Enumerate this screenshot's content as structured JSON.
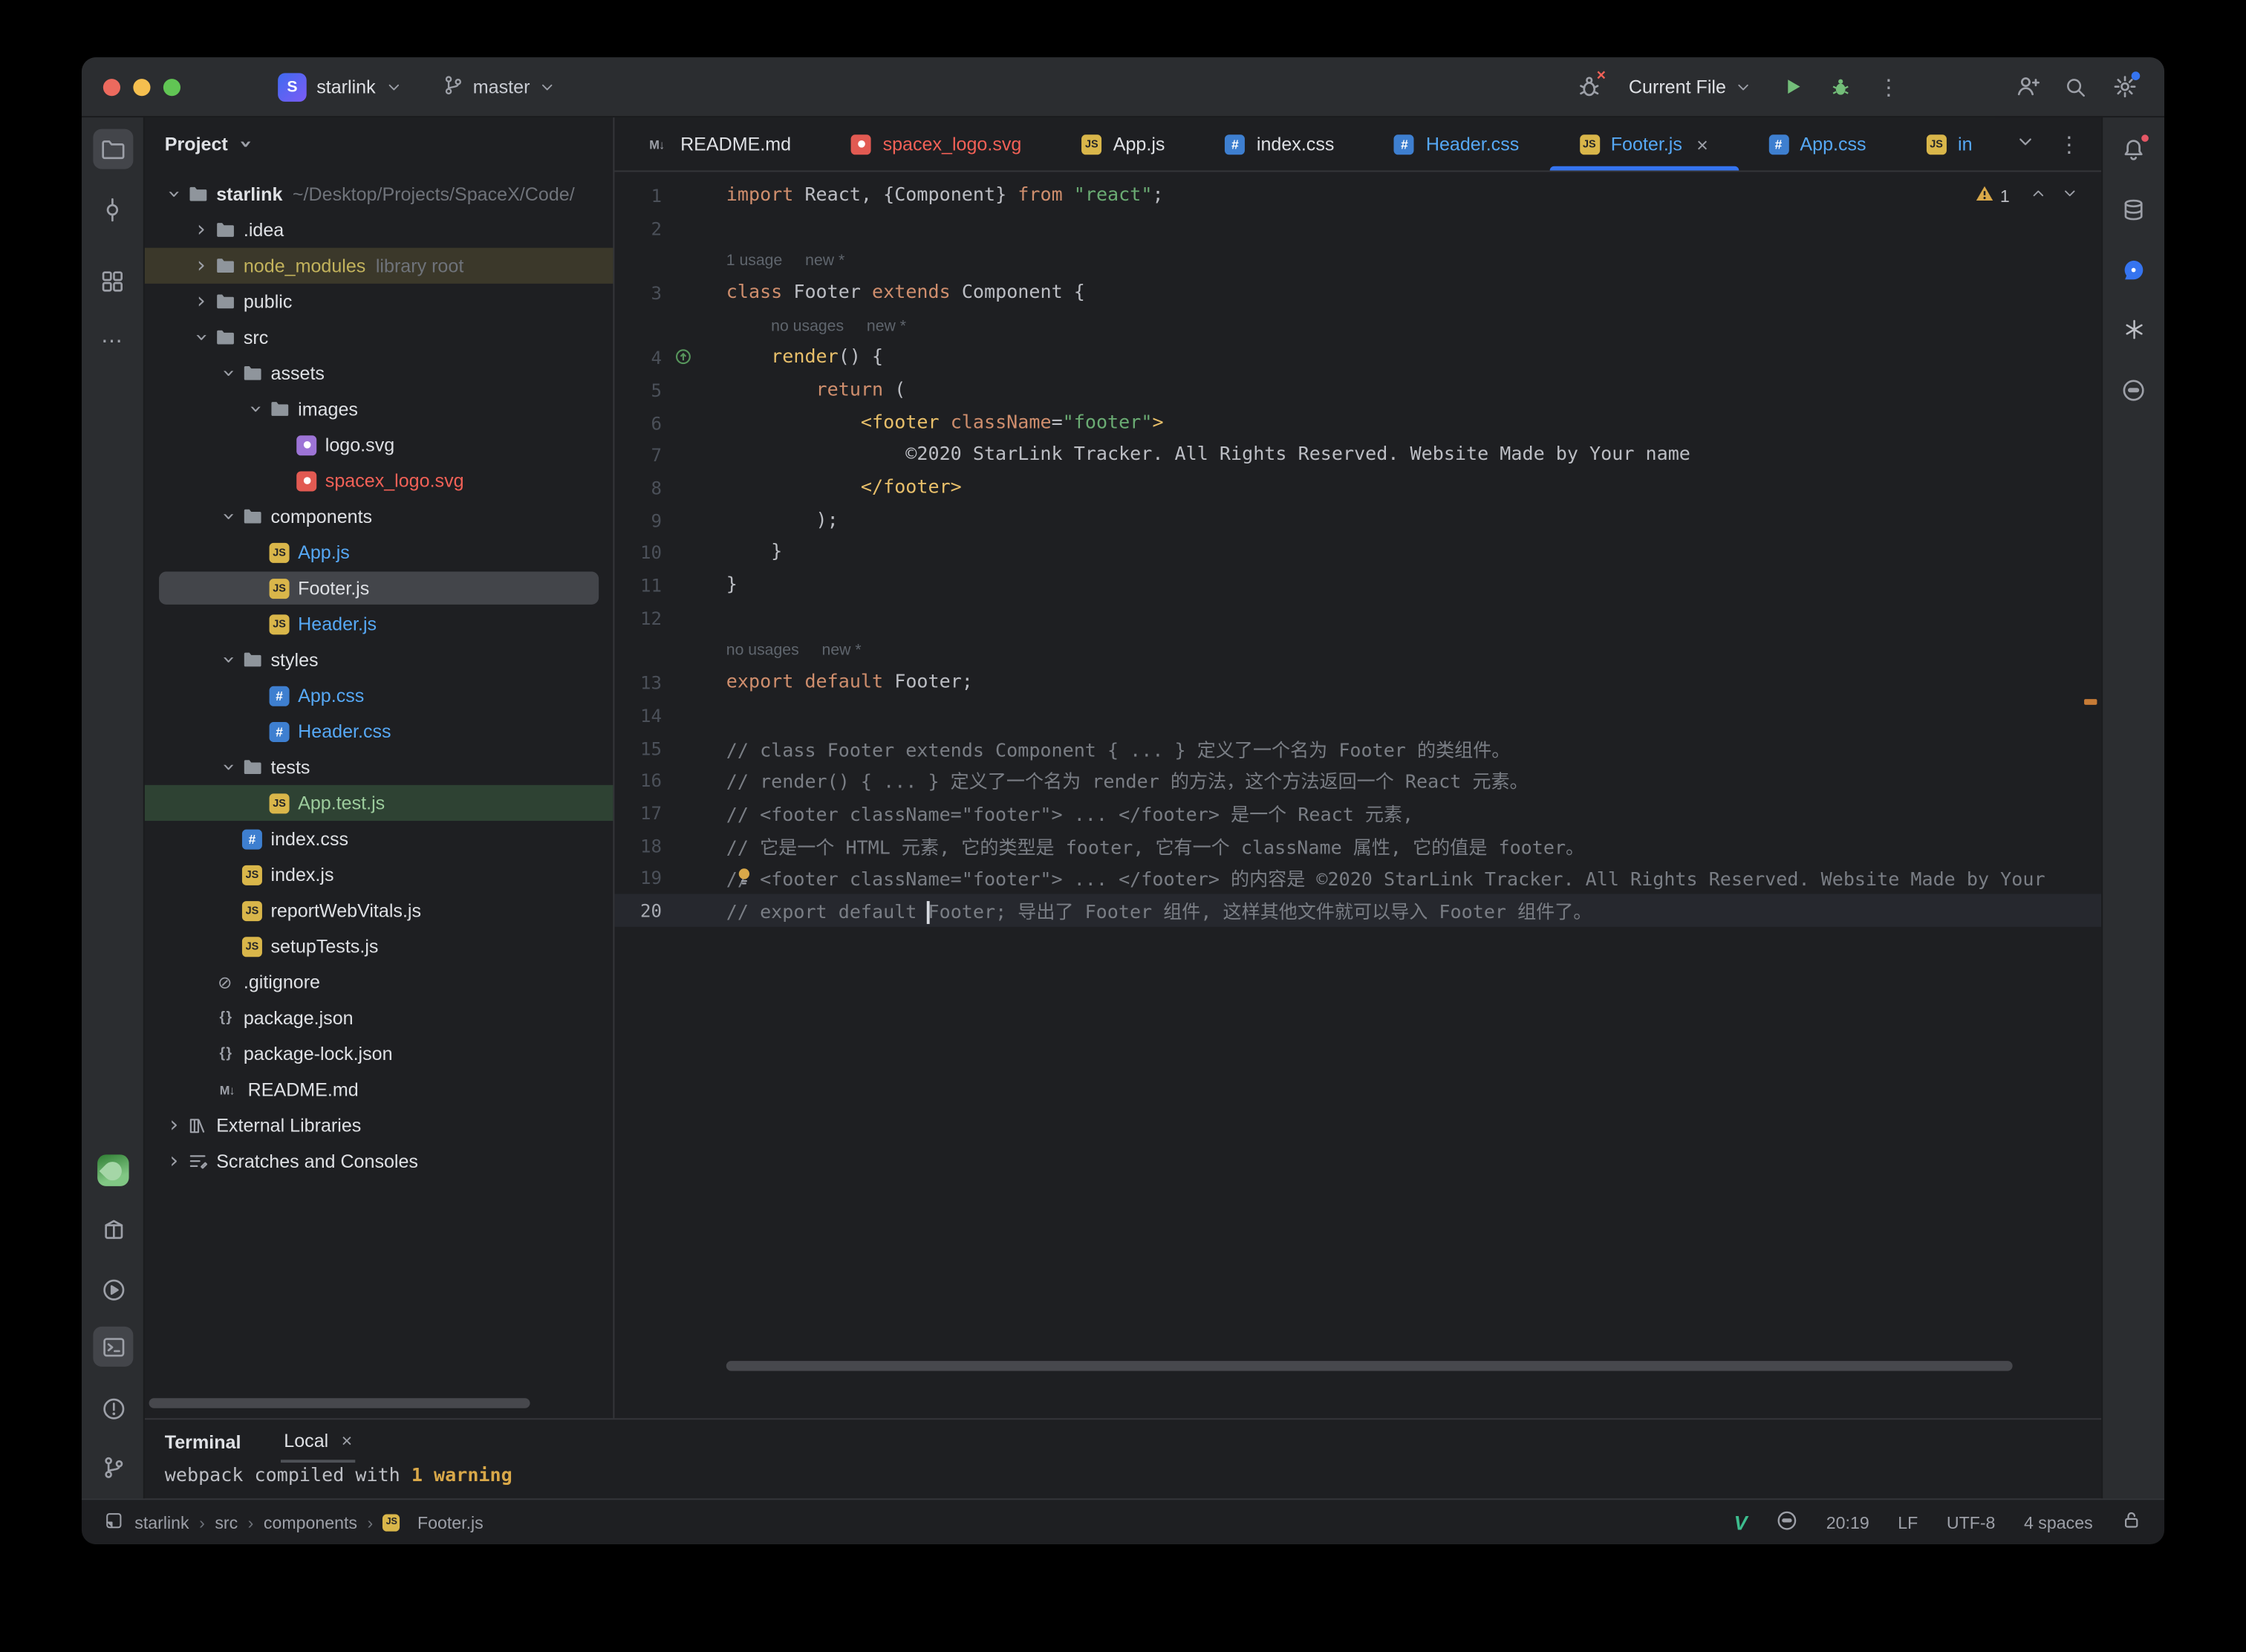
{
  "colors": {
    "accent_blue": "#3574f0",
    "modified_blue": "#56a8f5",
    "error_red": "#f26157",
    "added_green": "#8fc88f",
    "warning_yellow": "#d9a849",
    "keyword_orange": "#cf8e6d",
    "string_green": "#6aab73",
    "comment_gray": "#7a7e85"
  },
  "titlebar": {
    "project": {
      "initial": "S",
      "name": "starlink"
    },
    "branch": "master",
    "run_config": "Current File"
  },
  "project_panel": {
    "title": "Project",
    "items": [
      {
        "label": "starlink",
        "suffix": "~/Desktop/Projects/SpaceX/Code/",
        "level": 0,
        "chevron": "expanded",
        "icon": "folder",
        "bold": true
      },
      {
        "label": ".idea",
        "level": 1,
        "chevron": "collapsed",
        "icon": "folder"
      },
      {
        "label": "node_modules",
        "suffix": "library root",
        "level": 1,
        "chevron": "collapsed",
        "icon": "folder",
        "rowBg": "#3b382a",
        "color": "#c3b35c"
      },
      {
        "label": "public",
        "level": 1,
        "chevron": "collapsed",
        "icon": "folder"
      },
      {
        "label": "src",
        "level": 1,
        "chevron": "expanded",
        "icon": "folder"
      },
      {
        "label": "assets",
        "level": 2,
        "chevron": "expanded",
        "icon": "folder"
      },
      {
        "label": "images",
        "level": 3,
        "chevron": "expanded",
        "icon": "folder"
      },
      {
        "label": "logo.svg",
        "level": 4,
        "icon": "img"
      },
      {
        "label": "spacex_logo.svg",
        "level": 4,
        "icon": "img-red",
        "color": "#f26157"
      },
      {
        "label": "components",
        "level": 2,
        "chevron": "expanded",
        "icon": "folder"
      },
      {
        "label": "App.js",
        "level": 3,
        "icon": "js",
        "color": "#56a8f5"
      },
      {
        "label": "Footer.js",
        "level": 3,
        "icon": "js",
        "selected": true
      },
      {
        "label": "Header.js",
        "level": 3,
        "icon": "js",
        "color": "#56a8f5"
      },
      {
        "label": "styles",
        "level": 2,
        "chevron": "expanded",
        "icon": "folder"
      },
      {
        "label": "App.css",
        "level": 3,
        "icon": "css",
        "color": "#56a8f5"
      },
      {
        "label": "Header.css",
        "level": 3,
        "icon": "css",
        "color": "#56a8f5"
      },
      {
        "label": "tests",
        "level": 2,
        "chevron": "expanded",
        "icon": "folder"
      },
      {
        "label": "App.test.js",
        "level": 3,
        "icon": "js",
        "rowBg": "#2e4233",
        "color": "#9ccc9c"
      },
      {
        "label": "index.css",
        "level": 2,
        "icon": "css"
      },
      {
        "label": "index.js",
        "level": 2,
        "icon": "js"
      },
      {
        "label": "reportWebVitals.js",
        "level": 2,
        "icon": "js"
      },
      {
        "label": "setupTests.js",
        "level": 2,
        "icon": "js"
      },
      {
        "label": ".gitignore",
        "level": 1,
        "icon": "ignore"
      },
      {
        "label": "package.json",
        "level": 1,
        "icon": "json"
      },
      {
        "label": "package-lock.json",
        "level": 1,
        "icon": "json"
      },
      {
        "label": "README.md",
        "level": 1,
        "icon": "md"
      },
      {
        "label": "External Libraries",
        "level": 0,
        "chevron": "collapsed",
        "icon": "lib"
      },
      {
        "label": "Scratches and Consoles",
        "level": 0,
        "chevron": "collapsed",
        "icon": "scratch"
      }
    ]
  },
  "editor_tabs": [
    {
      "label": "README.md",
      "icon": "md"
    },
    {
      "label": "spacex_logo.svg",
      "icon": "img-red",
      "color": "#f26157"
    },
    {
      "label": "App.js",
      "icon": "js"
    },
    {
      "label": "index.css",
      "icon": "css"
    },
    {
      "label": "Header.css",
      "icon": "css",
      "color": "#56a8f5"
    },
    {
      "label": "Footer.js",
      "icon": "js",
      "color": "#56a8f5",
      "active": true,
      "close": true
    },
    {
      "label": "App.css",
      "icon": "css",
      "color": "#56a8f5"
    },
    {
      "label": "in",
      "icon": "js",
      "color": "#56a8f5"
    }
  ],
  "editor": {
    "warning_count": "1",
    "rows": [
      {
        "n": "1",
        "s": [
          [
            "kw",
            "import"
          ],
          [
            "pl",
            " React, {Component} "
          ],
          [
            "kw",
            "from"
          ],
          [
            "pl",
            " "
          ],
          [
            "st",
            "\"react\""
          ],
          [
            "pl",
            ";"
          ]
        ]
      },
      {
        "n": "2",
        "s": []
      },
      {
        "inlay": [
          "1 usage",
          "new *"
        ],
        "pad": ""
      },
      {
        "n": "3",
        "s": [
          [
            "kw",
            "class"
          ],
          [
            "pl",
            " Footer "
          ],
          [
            "kw",
            "extends"
          ],
          [
            "pl",
            " Component {"
          ]
        ]
      },
      {
        "inlay": [
          "no usages",
          "new *"
        ],
        "pad": "    "
      },
      {
        "n": "4",
        "s": [
          [
            "pl",
            "    "
          ],
          [
            "fn",
            "render"
          ],
          [
            "pl",
            "() {"
          ]
        ],
        "gutter": "override"
      },
      {
        "n": "5",
        "s": [
          [
            "pl",
            "        "
          ],
          [
            "kw",
            "return"
          ],
          [
            "pl",
            " ("
          ]
        ]
      },
      {
        "n": "6",
        "s": [
          [
            "pl",
            "            "
          ],
          [
            "tg",
            "<footer "
          ],
          [
            "at",
            "className"
          ],
          [
            "pl",
            "="
          ],
          [
            "st",
            "\"footer\""
          ],
          [
            "tg",
            ">"
          ]
        ]
      },
      {
        "n": "7",
        "s": [
          [
            "pl",
            "                ©2020 StarLink Tracker. All Rights Reserved. Website Made by Your name"
          ]
        ]
      },
      {
        "n": "8",
        "s": [
          [
            "pl",
            "            "
          ],
          [
            "tg",
            "</footer>"
          ]
        ]
      },
      {
        "n": "9",
        "s": [
          [
            "pl",
            "        );"
          ]
        ]
      },
      {
        "n": "10",
        "s": [
          [
            "pl",
            "    }"
          ]
        ]
      },
      {
        "n": "11",
        "s": [
          [
            "pl",
            "}"
          ]
        ]
      },
      {
        "n": "12",
        "s": []
      },
      {
        "inlay": [
          "no usages",
          "new *"
        ],
        "pad": ""
      },
      {
        "n": "13",
        "s": [
          [
            "kw",
            "export"
          ],
          [
            "pl",
            " "
          ],
          [
            "kw",
            "default"
          ],
          [
            "pl",
            " Footer;"
          ]
        ]
      },
      {
        "n": "14",
        "s": []
      },
      {
        "n": "15",
        "s": [
          [
            "cm",
            "// class Footer extends Component { ... } 定义了一个名为 Footer 的类组件。"
          ]
        ]
      },
      {
        "n": "16",
        "s": [
          [
            "cm",
            "// render() { ... } 定义了一个名为 render 的方法，这个方法返回一个 React 元素。"
          ]
        ]
      },
      {
        "n": "17",
        "s": [
          [
            "cm",
            "// <footer className=\"footer\"> ... </footer> 是一个 React 元素,"
          ]
        ]
      },
      {
        "n": "18",
        "s": [
          [
            "cm",
            "// 它是一个 HTML 元素, 它的类型是 footer, 它有一个 className 属性, 它的值是 footer。"
          ]
        ]
      },
      {
        "n": "19",
        "s": [
          [
            "cm",
            "// <footer className=\"footer\"> ... </footer> 的内容是 ©2020 StarLink Tracker. All Rights Reserved. Website Made by Your"
          ]
        ],
        "bulb": true
      },
      {
        "n": "20",
        "s": [
          [
            "cm",
            "// export default "
          ],
          [
            "caret",
            ""
          ],
          [
            "cm",
            "Footer; 导出了 Footer 组件, 这样其他文件就可以导入 Footer 组件了。"
          ]
        ],
        "current": true
      }
    ]
  },
  "terminal": {
    "title": "Terminal",
    "tab_label": "Local",
    "output": [
      [
        "pl",
        "webpack compiled with "
      ],
      [
        "warn",
        "1 warning"
      ]
    ]
  },
  "statusbar": {
    "breadcrumbs": [
      "starlink",
      "src",
      "components",
      "Footer.js"
    ],
    "caret_position": "20:19",
    "line_ending": "LF",
    "encoding": "UTF-8",
    "indent": "4 spaces"
  }
}
